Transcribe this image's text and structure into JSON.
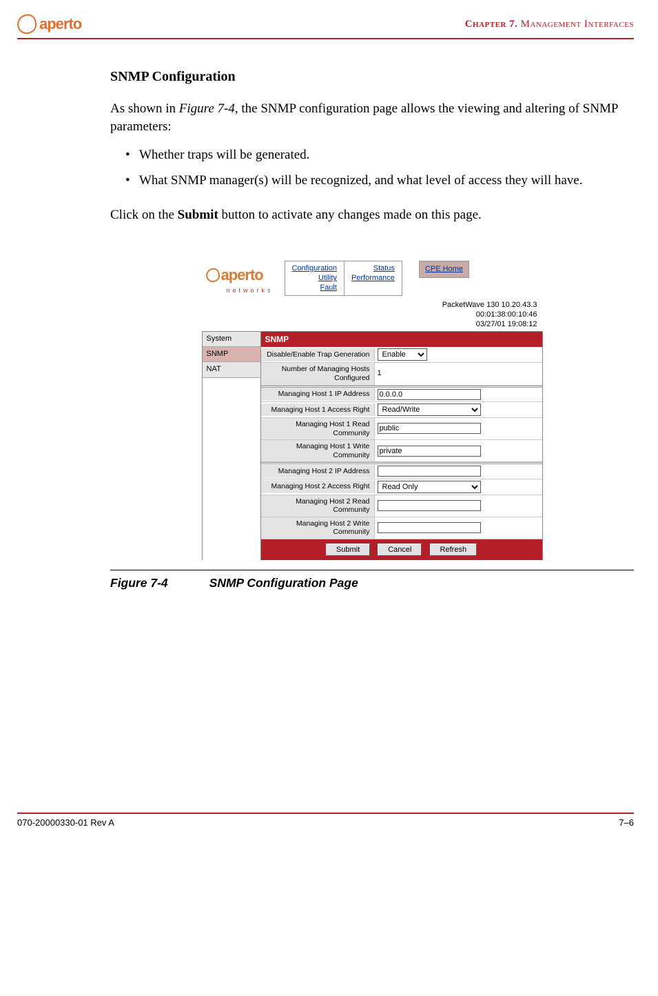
{
  "header": {
    "logo_text": "aperto",
    "chapter_prefix": "Chapter 7.",
    "chapter_title": "  Management Interfaces"
  },
  "section_title": "SNMP Configuration",
  "intro_pre": "As shown in ",
  "intro_ref": "Figure 7-4",
  "intro_post": ", the SNMP configuration page allows the viewing and altering of SNMP parameters:",
  "bullets": [
    "Whether traps will be generated.",
    "What SNMP manager(s) will be recognized, and what level of access they will have."
  ],
  "click_pre": "Click on the ",
  "click_bold": "Submit",
  "click_post": " button to activate any changes made on this page.",
  "screenshot": {
    "logo_text": "aperto",
    "logo_sub": "networks",
    "nav_col1": [
      "Configuration",
      "Utility",
      "Fault"
    ],
    "nav_col2": [
      "Status",
      "Performance"
    ],
    "cpe_home": "CPE Home",
    "device_line1": "PacketWave 130    10.20.43.3    00:01:38:00:10:46",
    "device_line2": "03/27/01    19:08:12",
    "sidebar": {
      "system": "System",
      "snmp": "SNMP",
      "nat": "NAT"
    },
    "panel_title": "SNMP",
    "rows": {
      "trap_label": "Disable/Enable Trap Generation",
      "trap_value": "Enable",
      "numhosts_label": "Number of Managing Hosts Configured",
      "numhosts_value": "1",
      "h1_ip_label": "Managing Host 1 IP Address",
      "h1_ip_value": "0.0.0.0",
      "h1_acc_label": "Managing Host 1 Access Right",
      "h1_acc_value": "Read/Write",
      "h1_rc_label": "Managing Host 1 Read Community",
      "h1_rc_value": "public",
      "h1_wc_label": "Managing Host 1 Write Community",
      "h1_wc_value": "private",
      "h2_ip_label": "Managing Host 2 IP Address",
      "h2_ip_value": "",
      "h2_acc_label": "Managing Host 2 Access Right",
      "h2_acc_value": "Read Only",
      "h2_rc_label": "Managing Host 2 Read Community",
      "h2_rc_value": "",
      "h2_wc_label": "Managing Host 2 Write Community",
      "h2_wc_value": ""
    },
    "buttons": {
      "submit": "Submit",
      "cancel": "Cancel",
      "refresh": "Refresh"
    }
  },
  "figure": {
    "num": "Figure 7-4",
    "title": "SNMP Configuration Page"
  },
  "footer": {
    "left": "070-20000330-01 Rev A",
    "right": "7–6"
  }
}
